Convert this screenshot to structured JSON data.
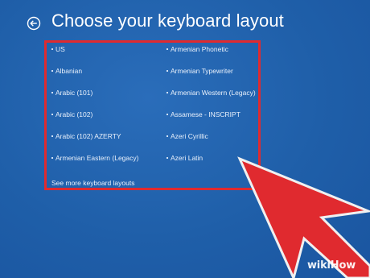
{
  "page": {
    "title": "Choose your keyboard layout",
    "back_icon": "back-arrow-circle-icon"
  },
  "layouts": {
    "left": [
      "US",
      "Albanian",
      "Arabic (101)",
      "Arabic (102)",
      "Arabic (102) AZERTY",
      "Armenian Eastern (Legacy)"
    ],
    "right": [
      "Armenian Phonetic",
      "Armenian Typewriter",
      "Armenian Western (Legacy)",
      "Assamese - INSCRIPT",
      "Azeri Cyrillic",
      "Azeri Latin"
    ],
    "see_more": "See more keyboard layouts"
  },
  "annotation": {
    "highlight_color": "#e02a2f",
    "arrow_color": "#e02a2f"
  },
  "watermark": {
    "text_a": "wiki",
    "text_b": "How"
  },
  "colors": {
    "background": "#1f5fa9",
    "text": "#ffffff"
  }
}
